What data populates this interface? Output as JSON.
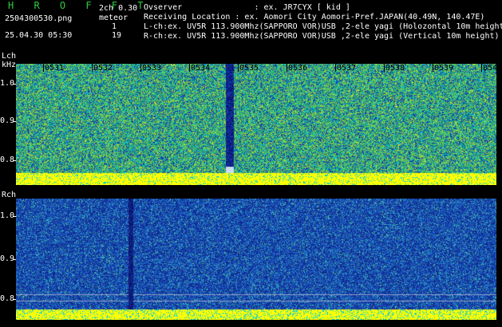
{
  "header": {
    "title": "H R O F F T",
    "filename": "2504300530.png",
    "datetime": "25.04.30 05:30",
    "version": "2ch 0.30",
    "meteor_label": "meteor",
    "meteor_lch": "1",
    "meteor_rch": "19",
    "observer": "Ovserver               : ex. JR7CYX [ kid ]",
    "location": "Receiving Location : ex. Aomori City Aomori-Pref.JAPAN(40.49N, 140.47E)",
    "lch_info": "L-ch:ex. UV5R 113.900Mhz(SAPPORO VOR)USB ,2-ele yagi (Holozontal 10m height)",
    "rch_info": "R-ch:ex. UV5R 113.900Mhz(SAPPORO VOR)USB ,2-ele yagi (Vertical 10m height)"
  },
  "lch": {
    "label": "Lch",
    "unit": "kHz",
    "yticks": [
      "1.0",
      "0.9",
      "0.8"
    ],
    "xticks": [
      "0531",
      "0532",
      "0533",
      "0534",
      "0535",
      "0536",
      "0537",
      "0538",
      "0539",
      "0540"
    ]
  },
  "rch": {
    "label": "Rch",
    "yticks": [
      "1.0",
      "0.9",
      "0.8"
    ]
  },
  "colors": {
    "lch_base": "#2a9a6a",
    "rch_base": "#1a3aa8",
    "yellow": "#ffff00",
    "cyan": "#00d8e8",
    "header_green": "#2ecc40"
  }
}
